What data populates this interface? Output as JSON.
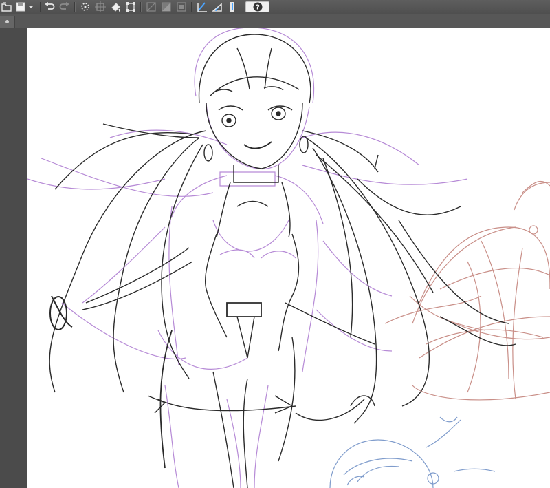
{
  "app": {
    "toolbar": {
      "buttons": [
        {
          "name": "open-file-icon",
          "enabled": true
        },
        {
          "name": "save-icon",
          "enabled": true
        },
        {
          "name": "save-menu-chevron-icon",
          "enabled": true
        },
        {
          "name": "undo-icon",
          "enabled": true
        },
        {
          "name": "redo-icon",
          "enabled": false
        },
        {
          "name": "deselect-icon",
          "enabled": true
        },
        {
          "name": "select-all-icon",
          "enabled": false
        },
        {
          "name": "fill-icon",
          "enabled": true
        },
        {
          "name": "transform-icon",
          "enabled": true
        },
        {
          "name": "clear-selection-icon",
          "enabled": false
        },
        {
          "name": "invert-selection-icon",
          "enabled": false
        },
        {
          "name": "select-layer-icon",
          "enabled": false
        },
        {
          "name": "ruler-snap-icon",
          "enabled": true
        },
        {
          "name": "special-ruler-snap-icon",
          "enabled": true
        },
        {
          "name": "grid-snap-icon",
          "enabled": true
        },
        {
          "name": "help-icon",
          "enabled": true
        }
      ],
      "help_glyph": "?"
    },
    "document_tab": {
      "indicator": "dot"
    },
    "canvas": {
      "background": "#ffffff",
      "layer_colors": {
        "line_art": "#2a2a2a",
        "purple_sketch": "#b68ad6",
        "red_sketch": "#c98f88",
        "blue_sketch": "#7f9ccc"
      }
    },
    "colors": {
      "toolbar_bg": "#555555",
      "workspace_bg": "#4b4b4b",
      "accent_blue": "#4aa3ff"
    }
  }
}
